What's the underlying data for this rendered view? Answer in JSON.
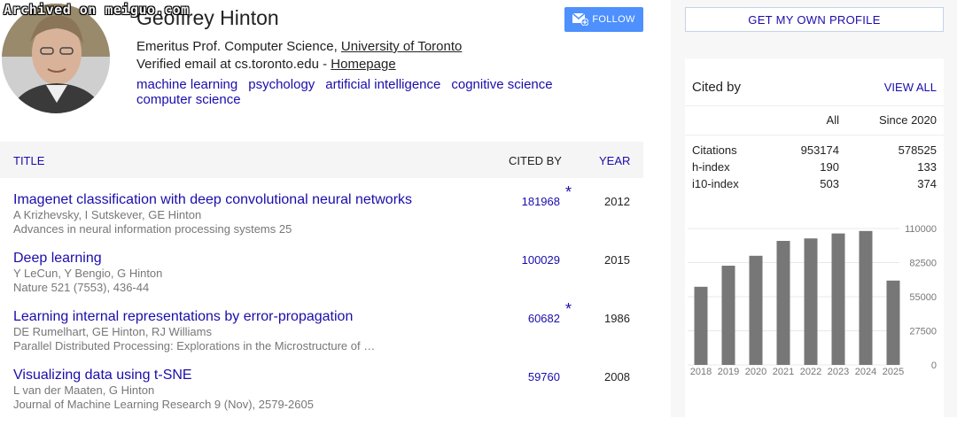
{
  "watermark": "Archived on meiguo.com",
  "profile": {
    "name": "Geoffrey Hinton",
    "affiliation_prefix": "Emeritus Prof. Computer Science, ",
    "affiliation_link": "University of Toronto",
    "email_text": "Verified email at cs.toronto.edu - ",
    "homepage_link": "Homepage",
    "interests": [
      "machine learning",
      "psychology",
      "artificial intelligence",
      "cognitive science",
      "computer science"
    ]
  },
  "follow_button": {
    "label": "FOLLOW",
    "icon": "mail-plus-icon"
  },
  "table": {
    "headers": {
      "title": "TITLE",
      "cited_by": "CITED BY",
      "year": "YEAR"
    },
    "articles": [
      {
        "title": "Imagenet classification with deep convolutional neural networks",
        "authors": "A Krizhevsky, I Sutskever, GE Hinton",
        "venue": "Advances in neural information processing systems 25",
        "cited_by": "181968",
        "starred": true,
        "year": "2012"
      },
      {
        "title": "Deep learning",
        "authors": "Y LeCun, Y Bengio, G Hinton",
        "venue": "Nature 521 (7553), 436-44",
        "cited_by": "100029",
        "starred": false,
        "year": "2015"
      },
      {
        "title": "Learning internal representations by error-propagation",
        "authors": "DE Rumelhart, GE Hinton, RJ Williams",
        "venue": "Parallel Distributed Processing: Explorations in the Microstructure of …",
        "cited_by": "60682",
        "starred": true,
        "year": "1986"
      },
      {
        "title": "Visualizing data using t-SNE",
        "authors": "L van der Maaten, G Hinton",
        "venue": "Journal of Machine Learning Research 9 (Nov), 2579-2605",
        "cited_by": "59760",
        "starred": false,
        "year": "2008"
      }
    ]
  },
  "sidebar": {
    "get_profile_label": "GET MY OWN PROFILE",
    "cited_by_title": "Cited by",
    "view_all_label": "VIEW ALL",
    "col_all": "All",
    "col_since": "Since 2020",
    "metrics": [
      {
        "label": "Citations",
        "all": "953174",
        "since": "578525"
      },
      {
        "label": "h-index",
        "all": "190",
        "since": "133"
      },
      {
        "label": "i10-index",
        "all": "503",
        "since": "374"
      }
    ]
  },
  "chart_data": {
    "type": "bar",
    "categories": [
      "2018",
      "2019",
      "2020",
      "2021",
      "2022",
      "2023",
      "2024",
      "2025"
    ],
    "values": [
      63000,
      80000,
      88000,
      100000,
      102000,
      106000,
      108000,
      68000
    ],
    "yticks": [
      0,
      27500,
      55000,
      82500,
      110000
    ],
    "ylim": [
      0,
      110000
    ],
    "bar_color": "#777777",
    "grid": true
  },
  "colors": {
    "link": "#1a0dab",
    "follow_bg": "#4d90fe",
    "bar": "#777777"
  }
}
